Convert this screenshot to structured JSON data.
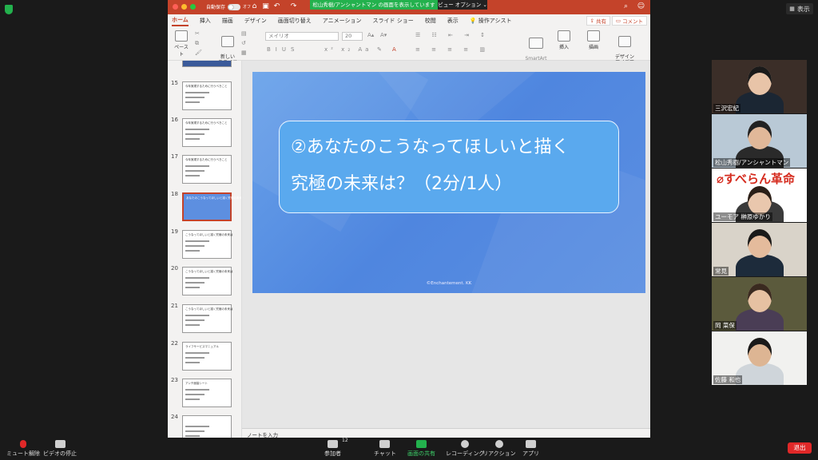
{
  "zoom": {
    "view_label": "表示",
    "share_banner": "松山秀樹/アンシャントマン の画面を表示しています",
    "view_options": "ビュー オプション ⌄",
    "leave_label": "退出"
  },
  "ppt": {
    "autosave_label": "自動保存",
    "autosave_state": "オフ",
    "tabs": [
      "ホーム",
      "挿入",
      "描画",
      "デザイン",
      "画面切り替え",
      "アニメーション",
      "スライド ショー",
      "校閲",
      "表示",
      "操作アシスト"
    ],
    "share_label": "共有",
    "comment_label": "コメント",
    "ribbon": {
      "paste": "ペースト",
      "new_slide": "新しい\nスライド",
      "font_name": "メイリオ",
      "font_size": "20",
      "smartart": "SmartArt\nに変換",
      "insert": "挿入",
      "draw": "描画",
      "designer": "デザイン\nアイデア"
    },
    "notes_placeholder": "ノートを入力"
  },
  "thumbnails": [
    {
      "num": "15",
      "title": "今年実現するために行うべきこと"
    },
    {
      "num": "16",
      "title": "今年実現するために行うべきこと"
    },
    {
      "num": "17",
      "title": "今年実現するために行うべきこと"
    },
    {
      "num": "18",
      "title": "あなたのこうなってほしいと描く究極の未来は？（2分/1人）"
    },
    {
      "num": "19",
      "title": "こうなってほしいと描く究極の未来は"
    },
    {
      "num": "20",
      "title": "こうなってほしいと描く究極の未来は"
    },
    {
      "num": "21",
      "title": "こうなってほしいと描く究極の未来は"
    },
    {
      "num": "22",
      "title": "ライフサービスマニュアル"
    },
    {
      "num": "23",
      "title": "アンチ面接シート"
    },
    {
      "num": "24",
      "title": ""
    }
  ],
  "slide": {
    "line1": "②あなたのこうなってほしいと描く",
    "line2": "究極の未来は？（2分/1人）",
    "copyright": "©Enchantement. KK"
  },
  "participants": [
    {
      "name": "三沢宏紀"
    },
    {
      "name": "松山秀樹/アンシャントマン"
    },
    {
      "name": "ユーモア 榊原ゆかり"
    },
    {
      "name": "常見"
    },
    {
      "name": "岡 菜保"
    },
    {
      "name": "佐藤 和也"
    }
  ],
  "bottombar": {
    "mute": "ミュート解除",
    "video": "ビデオの停止",
    "participants": "参加者",
    "participants_count": "12",
    "chat": "チャット",
    "share": "画面の共有",
    "record": "レコーディング",
    "reaction": "リアクション",
    "apps": "アプリ"
  },
  "colors": {
    "ppt_accent": "#c4432a",
    "zoom_green": "#23b14d",
    "leave_red": "#e02828",
    "slide_blue": "#5b8fe2"
  }
}
